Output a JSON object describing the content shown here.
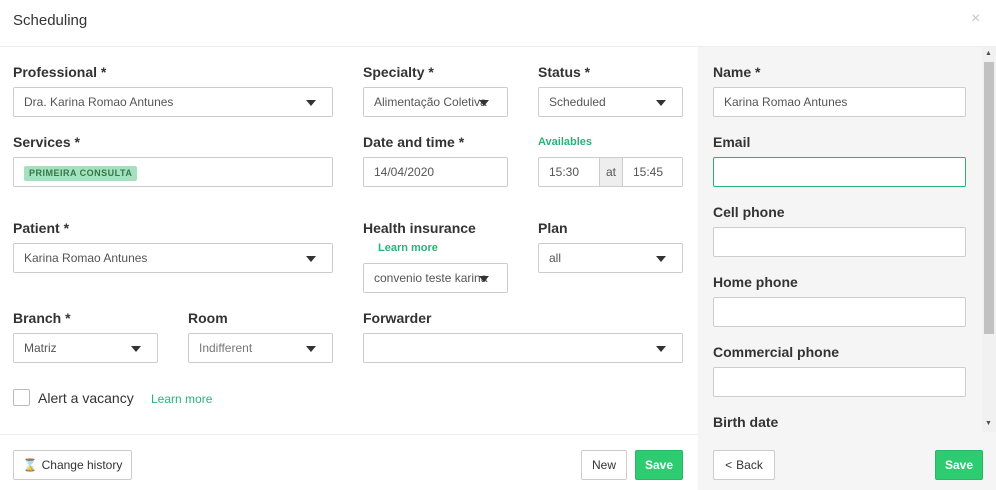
{
  "header": {
    "title": "Scheduling",
    "close_symbol": "×"
  },
  "form": {
    "professional": {
      "label": "Professional *",
      "value": "Dra. Karina Romao Antunes"
    },
    "specialty": {
      "label": "Specialty *",
      "value": "Alimentação Coletiva"
    },
    "status": {
      "label": "Status *",
      "value": "Scheduled"
    },
    "services": {
      "label": "Services *",
      "tag": "PRIMEIRA CONSULTA"
    },
    "date_time": {
      "label": "Date and time *",
      "value": "14/04/2020"
    },
    "availables": {
      "link": "Availables",
      "start": "15:30",
      "separator": "at",
      "end": "15:45"
    },
    "patient": {
      "label": "Patient *",
      "value": "Karina Romao Antunes"
    },
    "health_insurance": {
      "label": "Health insurance",
      "learn_more": "Learn more",
      "value": "convenio teste karina"
    },
    "plan": {
      "label": "Plan",
      "value": "all"
    },
    "branch": {
      "label": "Branch *",
      "value": "Matriz"
    },
    "room": {
      "label": "Room",
      "value": "Indifferent"
    },
    "forwarder": {
      "label": "Forwarder",
      "value": ""
    },
    "alert_vacancy": {
      "label": "Alert a vacancy",
      "learn_more": "Learn more",
      "checked": false
    }
  },
  "patient_panel": {
    "name": {
      "label": "Name *",
      "value": "Karina Romao Antunes"
    },
    "email": {
      "label": "Email",
      "value": ""
    },
    "cell_phone": {
      "label": "Cell phone",
      "value": ""
    },
    "home_phone": {
      "label": "Home phone",
      "value": ""
    },
    "commercial_phone": {
      "label": "Commercial phone",
      "value": ""
    },
    "birth_date": {
      "label": "Birth date"
    }
  },
  "footer": {
    "change_history": "Change history",
    "new": "New",
    "save": "Save",
    "back": "Back",
    "save_right": "Save"
  },
  "colors": {
    "accent_green": "#2ecc71",
    "link_green": "#2ab27b",
    "tag_bg": "#a7e0be",
    "panel_bg": "#f5f5f5"
  },
  "icons": {
    "close": "close-icon",
    "dropdown": "caret-down-icon",
    "history": "hourglass-icon",
    "back": "chevron-left-icon"
  }
}
